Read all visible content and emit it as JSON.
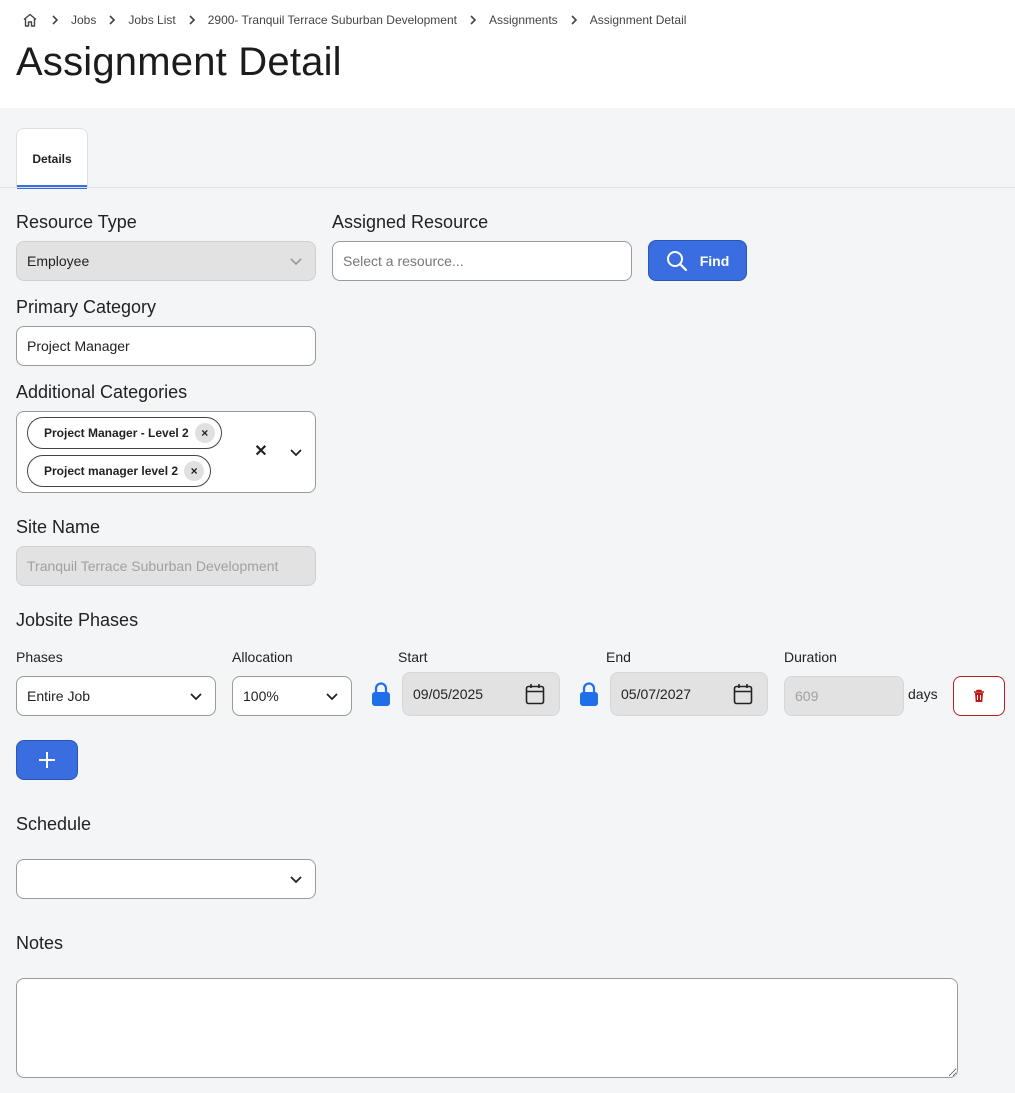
{
  "breadcrumb": {
    "items": [
      "Jobs",
      "Jobs List",
      "2900- Tranquil Terrace Suburban Development",
      "Assignments",
      "Assignment Detail"
    ]
  },
  "page": {
    "title": "Assignment Detail"
  },
  "tabs": [
    {
      "label": "Details",
      "active": true
    }
  ],
  "form": {
    "resource_type": {
      "label": "Resource Type",
      "value": "Employee"
    },
    "assigned_resource": {
      "label": "Assigned Resource",
      "placeholder": "Select a resource...",
      "find_label": "Find"
    },
    "primary_category": {
      "label": "Primary Category",
      "value": "Project Manager"
    },
    "additional_categories": {
      "label": "Additional Categories",
      "chips": [
        "Project Manager - Level 2",
        "Project manager level 2"
      ]
    },
    "site_name": {
      "label": "Site Name",
      "value": "Tranquil Terrace Suburban Development"
    },
    "jobsite_phases": {
      "label": "Jobsite Phases",
      "columns": {
        "phases": "Phases",
        "allocation": "Allocation",
        "start": "Start",
        "end": "End",
        "duration": "Duration"
      },
      "row": {
        "phase": "Entire Job",
        "allocation": "100%",
        "start": "09/05/2025",
        "end": "05/07/2027",
        "duration": "609",
        "duration_unit": "days"
      }
    },
    "schedule": {
      "label": "Schedule",
      "value": ""
    },
    "notes": {
      "label": "Notes",
      "value": ""
    }
  },
  "colors": {
    "primary": "#3a6ee0",
    "danger": "#b32020",
    "lock": "#1f6fe8"
  }
}
